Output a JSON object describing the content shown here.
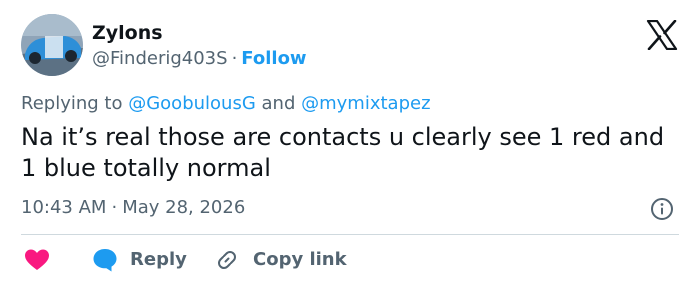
{
  "author": {
    "name": "Zylons",
    "handle": "@Finderig403S",
    "separator": "·",
    "follow_label": "Follow"
  },
  "reply_context": {
    "prefix": "Replying to",
    "mention_1": "@GoobulousG",
    "conjunction": "and",
    "mention_2": "@mymixtapez"
  },
  "tweet": {
    "text": "Na it’s real those are contacts u clearly see 1 red and 1 blue totally normal",
    "time": "10:43 AM",
    "separator": "·",
    "date": "May 28, 2026"
  },
  "actions": {
    "reply_label": "Reply",
    "copy_label": "Copy link"
  },
  "icons": {
    "logo": "x-logo-icon",
    "info": "info-icon",
    "like": "heart-icon",
    "reply": "speech-bubble-icon",
    "copy": "link-icon"
  },
  "colors": {
    "text_primary": "#0f1419",
    "text_secondary": "#536471",
    "link": "#1d9bf0",
    "like": "#f91880",
    "divider": "#cfd9de"
  }
}
